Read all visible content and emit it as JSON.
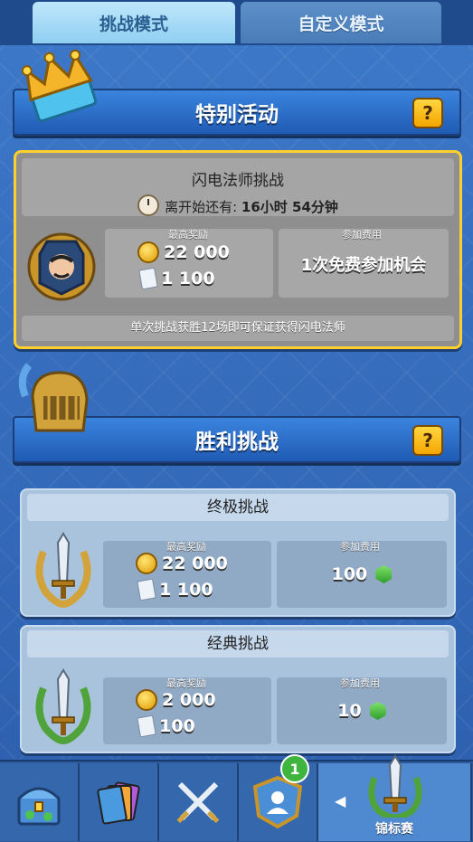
{
  "tabs": {
    "active": "挑战模式",
    "inactive": "自定义模式"
  },
  "special_event": {
    "banner": "特别活动",
    "help": "?",
    "title": "闪电法师挑战",
    "timer_prefix": "离开始还有:",
    "timer_value": "16小时 54分钟",
    "reward_label": "最高奖励",
    "reward_gold": "22 000",
    "reward_cards": "1 100",
    "fee_label": "参加费用",
    "fee_value": "1次免费参加机会",
    "footer": "单次挑战获胜12场即可保证获得闪电法师"
  },
  "victory": {
    "banner": "胜利挑战",
    "help": "?",
    "challenges": [
      {
        "title": "终极挑战",
        "reward_label": "最高奖励",
        "gold": "22 000",
        "cards": "1 100",
        "fee_label": "参加费用",
        "fee": "100"
      },
      {
        "title": "经典挑战",
        "reward_label": "最高奖励",
        "gold": "2 000",
        "cards": "100",
        "fee_label": "参加费用",
        "fee": "10"
      }
    ]
  },
  "nav": {
    "items": [
      {
        "icon": "chest-icon"
      },
      {
        "icon": "cards-icon"
      },
      {
        "icon": "swords-icon"
      },
      {
        "icon": "clan-icon",
        "badge": "1"
      },
      {
        "icon": "tournament-sword-icon",
        "label": "锦标赛",
        "selected": true
      }
    ],
    "arrow": "◀"
  },
  "colors": {
    "gold_border": "#ffcf2e",
    "banner_blue": "#2a6dc9",
    "gem_green": "#3fb53f"
  }
}
